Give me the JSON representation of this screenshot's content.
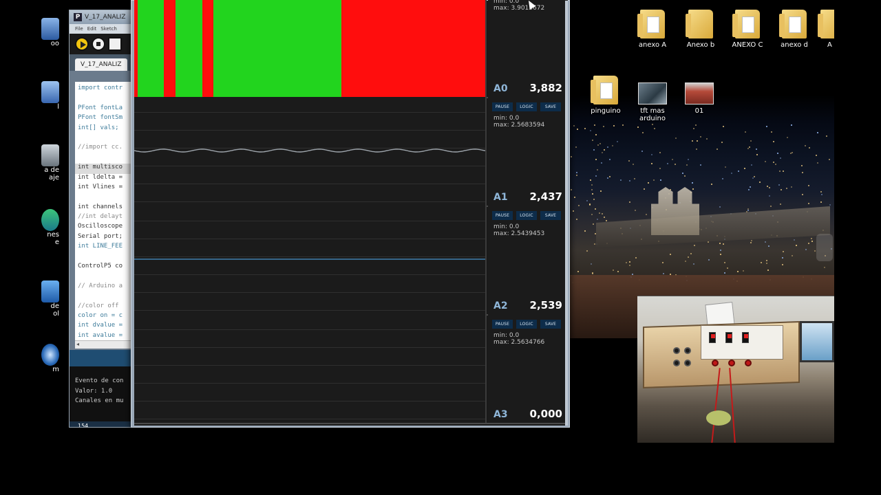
{
  "ide": {
    "title": "V_17_ANALIZ",
    "menu": [
      "File",
      "Edit",
      "Sketch"
    ],
    "tab_label": "V_17_ANALIZ",
    "code_lines": [
      {
        "text": "import contr",
        "cls": "kw"
      },
      {
        "text": "",
        "cls": ""
      },
      {
        "text": "PFont fontLa",
        "cls": "kw"
      },
      {
        "text": "PFont fontSm",
        "cls": "kw"
      },
      {
        "text": "int[] vals;",
        "cls": "kw"
      },
      {
        "text": "",
        "cls": ""
      },
      {
        "text": "//import cc.",
        "cls": "cm"
      },
      {
        "text": "",
        "cls": ""
      },
      {
        "text": "int multisco",
        "cls": "hl"
      },
      {
        "text": "int ldelta =",
        "cls": ""
      },
      {
        "text": "int Vlines =",
        "cls": ""
      },
      {
        "text": "",
        "cls": ""
      },
      {
        "text": "int channels",
        "cls": ""
      },
      {
        "text": "//int delayt",
        "cls": "cm"
      },
      {
        "text": "Oscilloscope",
        "cls": ""
      },
      {
        "text": "Serial port;",
        "cls": ""
      },
      {
        "text": "int LINE_FEE",
        "cls": "kw"
      },
      {
        "text": "",
        "cls": ""
      },
      {
        "text": "ControlP5 co",
        "cls": ""
      },
      {
        "text": "",
        "cls": ""
      },
      {
        "text": "// Arduino a",
        "cls": "cm"
      },
      {
        "text": "",
        "cls": ""
      },
      {
        "text": "//color off",
        "cls": "cm"
      },
      {
        "text": "color on = c",
        "cls": "kw"
      },
      {
        "text": "int dvalue =",
        "cls": "kw"
      },
      {
        "text": "int avalue =",
        "cls": "kw"
      }
    ],
    "console_lines": [
      "",
      "Evento de con",
      "Valor: 1.0",
      "Canales en mu"
    ],
    "status_text": "154"
  },
  "scope": {
    "button_labels": {
      "pause": "PAUSE",
      "logic": "LOGIC",
      "save": "SAVE"
    },
    "channels": [
      {
        "name": "A0",
        "value": "3,882",
        "min": "min: 0.0",
        "max": "max: 3.9013672",
        "mode": "logic"
      },
      {
        "name": "A1",
        "value": "2,437",
        "min": "min: 0.0",
        "max": "max: 2.5683594",
        "mode": "wave"
      },
      {
        "name": "A2",
        "value": "2,539",
        "min": "min: 0.0",
        "max": "max: 2.5439453",
        "mode": "flat"
      },
      {
        "name": "A3",
        "value": "0,000",
        "min": "min: 0.0",
        "max": "max: 2.5634766",
        "mode": "empty"
      }
    ],
    "colors": {
      "logic_high": "#22d41e",
      "logic_low": "#ff0d0d",
      "trace": "#9fa6ad",
      "trace_flat": "#3f7fb0"
    }
  },
  "desktop": {
    "icons": [
      {
        "label": "anexo A",
        "kind": "folder"
      },
      {
        "label": "Anexo b",
        "kind": "folder"
      },
      {
        "label": "ANEXO C",
        "kind": "folder"
      },
      {
        "label": "anexo d",
        "kind": "folder"
      },
      {
        "label": "A",
        "kind": "folder"
      },
      {
        "label": "pinguino",
        "kind": "folder"
      },
      {
        "label": "tft mas arduino",
        "kind": "image"
      },
      {
        "label": "01",
        "kind": "image"
      }
    ],
    "left_labels": [
      "oo",
      "l",
      "a de",
      "aje",
      "nes",
      "e",
      "de",
      "ol",
      "m"
    ]
  }
}
